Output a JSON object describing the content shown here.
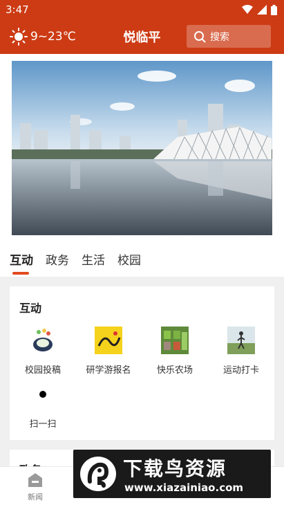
{
  "status": {
    "time": "3:47"
  },
  "header": {
    "weather": "9~23℃",
    "title": "悦临平",
    "search_placeholder": "搜索"
  },
  "tabs": [
    {
      "label": "互动",
      "active": true
    },
    {
      "label": "政务",
      "active": false
    },
    {
      "label": "生活",
      "active": false
    },
    {
      "label": "校园",
      "active": false
    }
  ],
  "card": {
    "title": "互动",
    "items": [
      {
        "label": "校园投稿",
        "icon": "campus-submission-icon"
      },
      {
        "label": "研学游报名",
        "icon": "study-tour-icon"
      },
      {
        "label": "快乐农场",
        "icon": "happy-farm-icon"
      },
      {
        "label": "运动打卡",
        "icon": "sports-checkin-icon"
      },
      {
        "label": "扫一扫",
        "icon": "scan-icon"
      }
    ]
  },
  "card2": {
    "title": "政务"
  },
  "bottom_nav": [
    {
      "label": "新闻",
      "icon": "news-icon"
    }
  ],
  "watermark": {
    "title": "下载鸟资源",
    "url": "www.xiazainiao.com"
  },
  "colors": {
    "brand": "#cc3b14",
    "accent": "#e24a1f"
  }
}
